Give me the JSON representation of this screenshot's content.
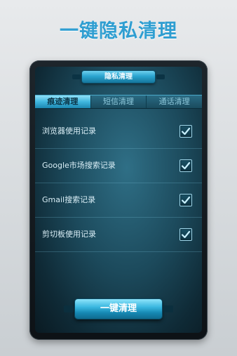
{
  "headline": "一键隐私清理",
  "panel": {
    "title": "隐私清理",
    "tabs": [
      {
        "label": "痕迹清理",
        "active": true
      },
      {
        "label": "短信清理",
        "active": false
      },
      {
        "label": "通话清理",
        "active": false
      }
    ],
    "items": [
      {
        "label": "浏览器使用记录",
        "checked": true
      },
      {
        "label": "Google市场搜索记录",
        "checked": true
      },
      {
        "label": "Gmail搜索记录",
        "checked": true
      },
      {
        "label": "剪切板使用记录",
        "checked": true
      }
    ],
    "clean_button": "一键清理"
  },
  "colors": {
    "headline": "#2f9ed1",
    "accent": "#3ab8e0",
    "check": "#9fd6ea"
  }
}
